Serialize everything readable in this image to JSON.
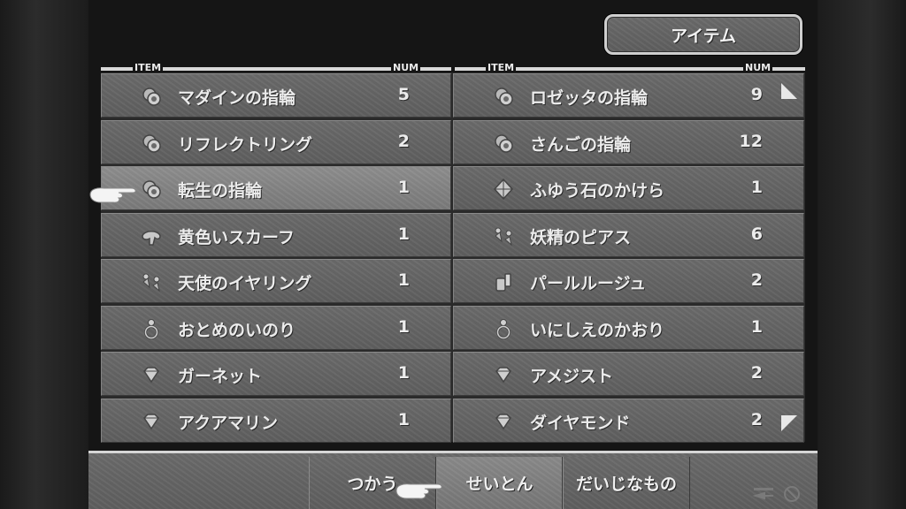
{
  "title": "アイテム",
  "headers": {
    "item": "ITEM",
    "num": "NUM"
  },
  "items": [
    {
      "name": "マダインの指輪",
      "num": "5",
      "icon": "ring-icon"
    },
    {
      "name": "ロゼッタの指輪",
      "num": "9",
      "icon": "ring-icon"
    },
    {
      "name": "リフレクトリング",
      "num": "2",
      "icon": "ring-icon"
    },
    {
      "name": "さんごの指輪",
      "num": "12",
      "icon": "ring-icon"
    },
    {
      "name": "転生の指輪",
      "num": "1",
      "icon": "ring-icon",
      "selected": true
    },
    {
      "name": "ふゆう石のかけら",
      "num": "1",
      "icon": "crystal-icon"
    },
    {
      "name": "黄色いスカーフ",
      "num": "1",
      "icon": "scarf-icon"
    },
    {
      "name": "妖精のピアス",
      "num": "6",
      "icon": "earring-icon"
    },
    {
      "name": "天使のイヤリング",
      "num": "1",
      "icon": "earring-icon"
    },
    {
      "name": "パールルージュ",
      "num": "2",
      "icon": "rouge-icon"
    },
    {
      "name": "おとめのいのり",
      "num": "1",
      "icon": "charm-icon"
    },
    {
      "name": "いにしえのかおり",
      "num": "1",
      "icon": "charm-icon"
    },
    {
      "name": "ガーネット",
      "num": "1",
      "icon": "gem-icon"
    },
    {
      "name": "アメジスト",
      "num": "2",
      "icon": "gem-icon"
    },
    {
      "name": "アクアマリン",
      "num": "1",
      "icon": "gem-icon"
    },
    {
      "name": "ダイヤモンド",
      "num": "2",
      "icon": "gem-icon"
    }
  ],
  "commands": [
    {
      "label": "つかう"
    },
    {
      "label": "せいとん",
      "active": true
    },
    {
      "label": "だいじなもの"
    }
  ],
  "colors": {
    "panel": "#646464",
    "selected": "#848484",
    "text": "#ececec",
    "border": "#d8d8d8"
  }
}
